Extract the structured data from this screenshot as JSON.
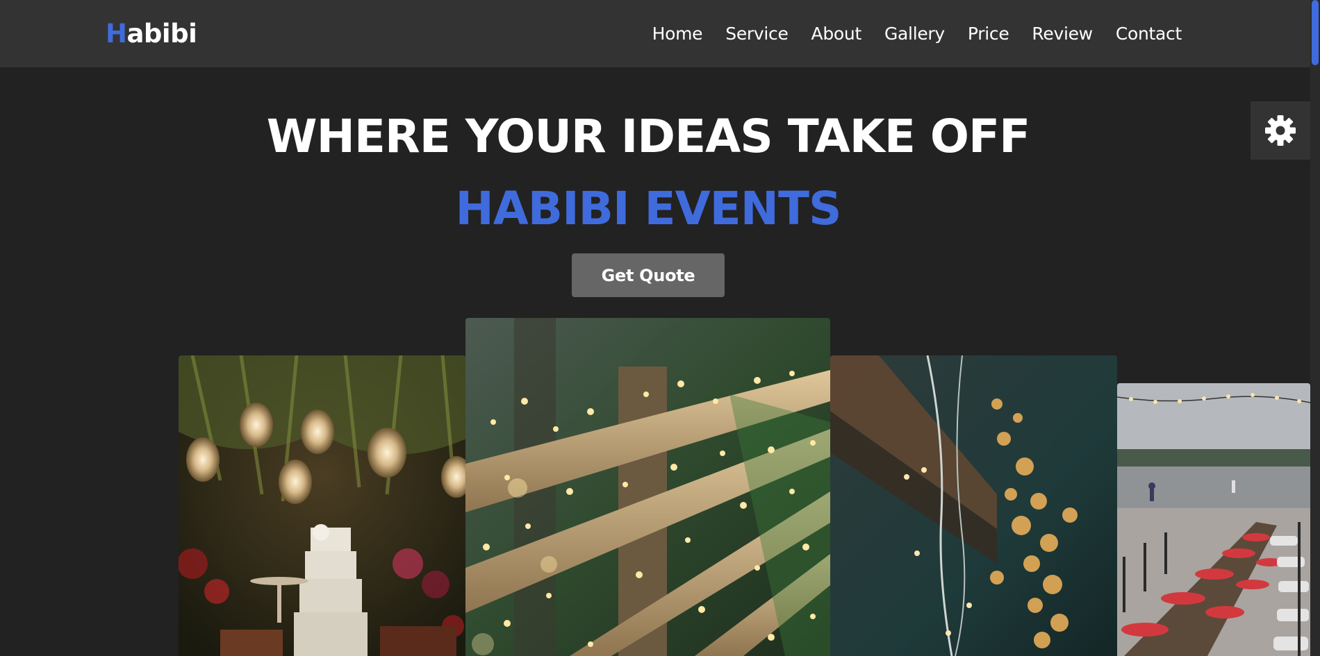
{
  "brand": {
    "logo_first_letter": "H",
    "logo_rest": "abibi"
  },
  "nav": {
    "items": [
      {
        "label": "Home"
      },
      {
        "label": "Service"
      },
      {
        "label": "About"
      },
      {
        "label": "Gallery"
      },
      {
        "label": "Price"
      },
      {
        "label": "Review"
      },
      {
        "label": "Contact"
      }
    ]
  },
  "hero": {
    "title": "WHERE YOUR IDEAS TAKE OFF",
    "subtitle": "HABIBI EVENTS",
    "cta_label": "Get Quote"
  },
  "icons": {
    "settings": "gear-icon"
  },
  "colors": {
    "accent": "#3f6bdc",
    "header_bg": "#333333",
    "page_bg": "#222222",
    "button_bg": "#666666"
  }
}
